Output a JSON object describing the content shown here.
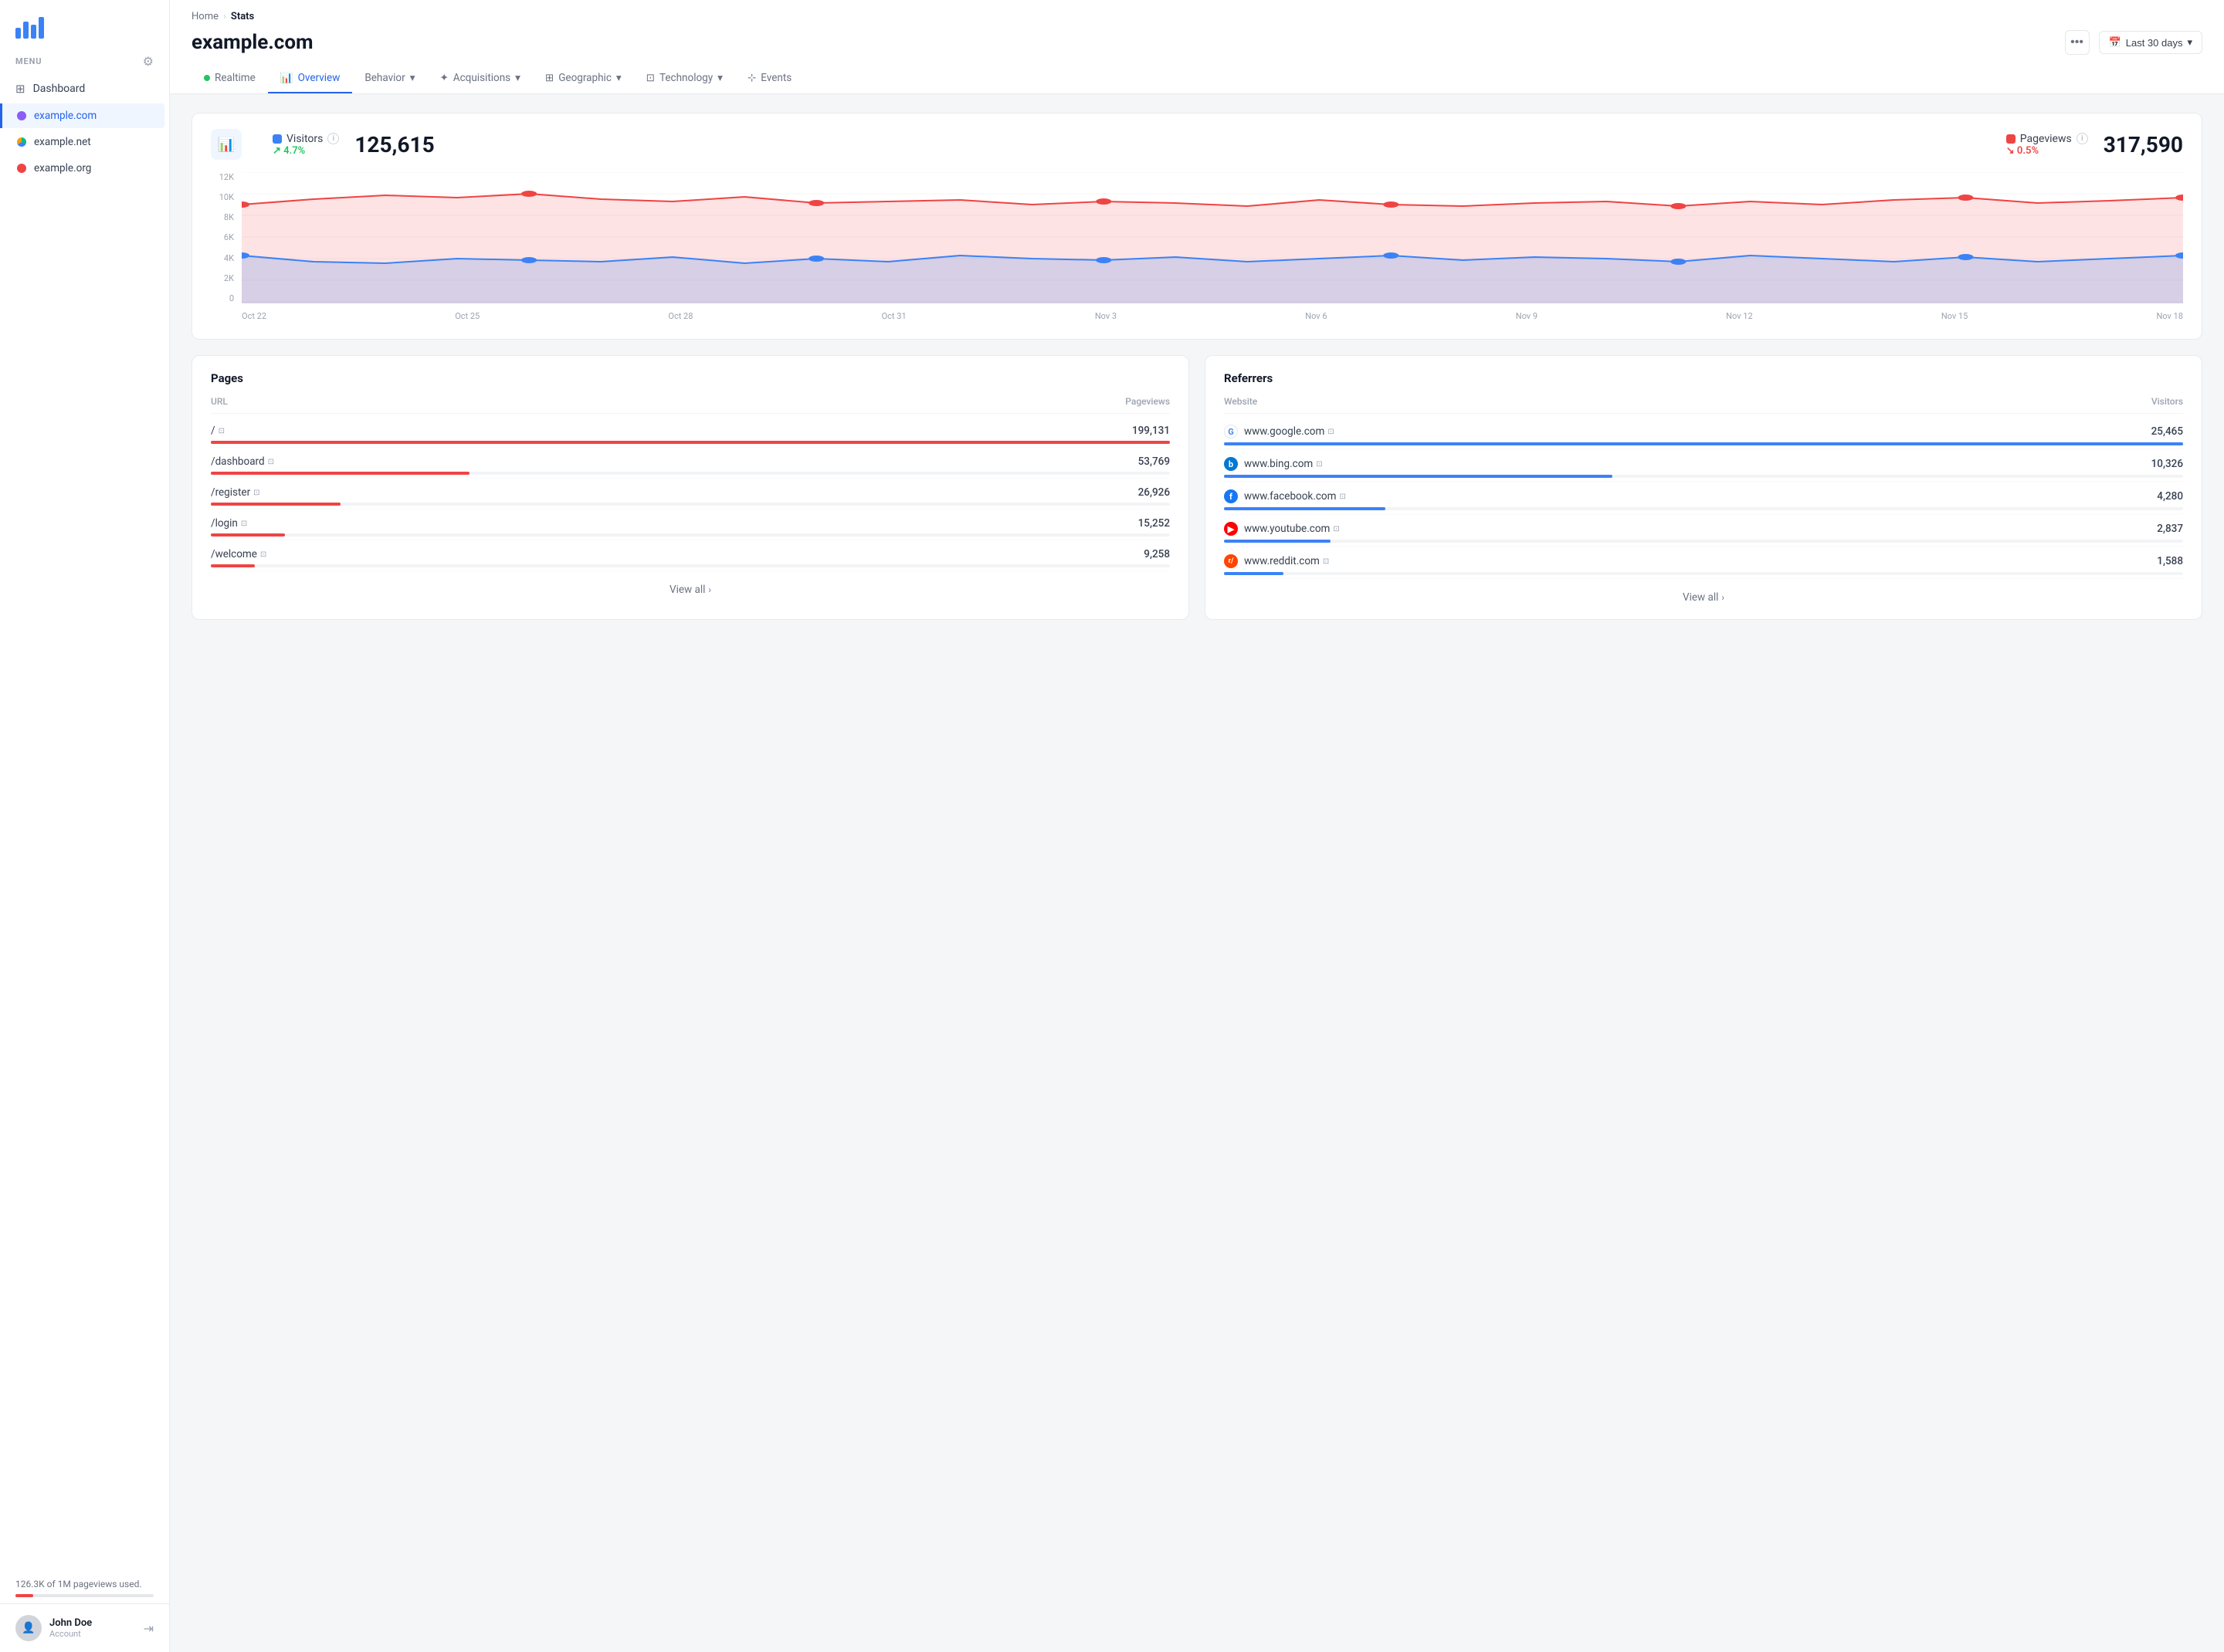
{
  "sidebar": {
    "menu_label": "MENU",
    "nav_items": [
      {
        "id": "dashboard",
        "label": "Dashboard",
        "icon": "⊞"
      }
    ],
    "sites": [
      {
        "id": "example-com",
        "label": "example.com",
        "color": "purple",
        "active": true
      },
      {
        "id": "example-net",
        "label": "example.net",
        "color": "green-multi",
        "active": false
      },
      {
        "id": "example-org",
        "label": "example.org",
        "color": "red",
        "active": false
      }
    ],
    "usage_text": "126.3K of 1M pageviews used.",
    "user": {
      "name": "John Doe",
      "role": "Account"
    }
  },
  "header": {
    "breadcrumb_home": "Home",
    "breadcrumb_current": "Stats",
    "page_title": "example.com",
    "more_label": "•••",
    "date_range": "Last 30 days"
  },
  "tabs": [
    {
      "id": "realtime",
      "label": "Realtime",
      "type": "dot"
    },
    {
      "id": "overview",
      "label": "Overview",
      "type": "chart",
      "active": true
    },
    {
      "id": "behavior",
      "label": "Behavior",
      "type": "dropdown"
    },
    {
      "id": "acquisitions",
      "label": "Acquisitions",
      "type": "dropdown"
    },
    {
      "id": "geographic",
      "label": "Geographic",
      "type": "dropdown"
    },
    {
      "id": "technology",
      "label": "Technology",
      "type": "dropdown"
    },
    {
      "id": "events",
      "label": "Events",
      "type": "target"
    }
  ],
  "stats": {
    "visitors_label": "Visitors",
    "visitors_change": "4.7%",
    "visitors_change_dir": "up",
    "visitors_value": "125,615",
    "pageviews_label": "Pageviews",
    "pageviews_change": "0.5%",
    "pageviews_change_dir": "down",
    "pageviews_value": "317,590"
  },
  "chart": {
    "y_labels": [
      "12K",
      "10K",
      "8K",
      "6K",
      "4K",
      "2K",
      "0"
    ],
    "x_labels": [
      "Oct 22",
      "Oct 25",
      "Oct 28",
      "Oct 31",
      "Nov 3",
      "Nov 6",
      "Nov 9",
      "Nov 12",
      "Nov 15",
      "Nov 18"
    ],
    "visitors_color": "#3b82f6",
    "pageviews_color": "#ef4444"
  },
  "pages_panel": {
    "title": "Pages",
    "col_url": "URL",
    "col_pageviews": "Pageviews",
    "rows": [
      {
        "url": "/",
        "value": "199,131",
        "bar_pct": 100
      },
      {
        "url": "/dashboard",
        "value": "53,769",
        "bar_pct": 27
      },
      {
        "url": "/register",
        "value": "26,926",
        "bar_pct": 13.5
      },
      {
        "url": "/login",
        "value": "15,252",
        "bar_pct": 7.7
      },
      {
        "url": "/welcome",
        "value": "9,258",
        "bar_pct": 4.6
      }
    ],
    "view_all": "View all"
  },
  "referrers_panel": {
    "title": "Referrers",
    "col_website": "Website",
    "col_visitors": "Visitors",
    "rows": [
      {
        "icon": "G",
        "icon_class": "ref-g",
        "url": "www.google.com",
        "value": "25,465",
        "bar_pct": 100
      },
      {
        "icon": "b",
        "icon_class": "ref-b",
        "url": "www.bing.com",
        "value": "10,326",
        "bar_pct": 40.5
      },
      {
        "icon": "f",
        "icon_class": "ref-f",
        "url": "www.facebook.com",
        "value": "4,280",
        "bar_pct": 16.8
      },
      {
        "icon": "▶",
        "icon_class": "ref-y",
        "url": "www.youtube.com",
        "value": "2,837",
        "bar_pct": 11.1
      },
      {
        "icon": "r",
        "icon_class": "ref-r",
        "url": "www.reddit.com",
        "value": "1,588",
        "bar_pct": 6.2
      }
    ],
    "view_all": "View all"
  }
}
